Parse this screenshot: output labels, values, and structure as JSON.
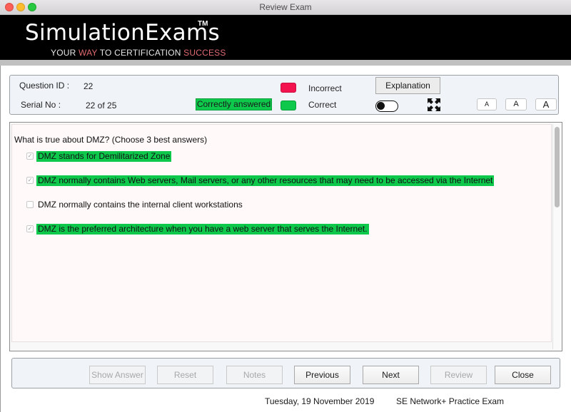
{
  "window": {
    "title": "Review Exam"
  },
  "banner": {
    "brand": "SimulationExams",
    "trademark": "TM",
    "tagline": {
      "part1": "YOUR ",
      "accent1": "WAY",
      "part2": " TO CERTIFICATION ",
      "accent2": "SUCCESS"
    }
  },
  "info": {
    "question_id_label": "Question ID :",
    "question_id_value": "22",
    "serial_label": "Serial No :",
    "serial_value": "22 of 25",
    "status_badge": "Correctly answered",
    "legend": [
      {
        "label": "Incorrect",
        "color": "#f2134f"
      },
      {
        "label": "Correct",
        "color": "#0ec84c"
      }
    ],
    "explanation_button": "Explanation",
    "toggle_state": "off",
    "font_size_buttons": [
      "A",
      "A",
      "A"
    ]
  },
  "question": {
    "text": "What is true about DMZ? (Choose 3 best answers)",
    "options": [
      {
        "text": "DMZ stands for Demilitarized Zone",
        "checked": true,
        "highlighted": true
      },
      {
        "text": "DMZ normally contains Web servers, Mail servers, or any other resources that may need to be accessed via the Internet",
        "checked": true,
        "highlighted": true
      },
      {
        "text": "DMZ normally contains the internal client workstations",
        "checked": false,
        "highlighted": false
      },
      {
        "text": "DMZ is the preferred architecture when you have a web server that serves the Internet.",
        "checked": true,
        "highlighted": true
      }
    ]
  },
  "nav": {
    "buttons": [
      {
        "label": "Show Answer",
        "enabled": false
      },
      {
        "label": "Reset",
        "enabled": false
      },
      {
        "label": "Notes",
        "enabled": false
      },
      {
        "label": "Previous",
        "enabled": true
      },
      {
        "label": "Next",
        "enabled": true
      },
      {
        "label": "Review",
        "enabled": false
      },
      {
        "label": "Close",
        "enabled": true
      }
    ]
  },
  "footer": {
    "date": "Tuesday, 19 November 2019",
    "exam_name": "SE Network+ Practice Exam"
  }
}
